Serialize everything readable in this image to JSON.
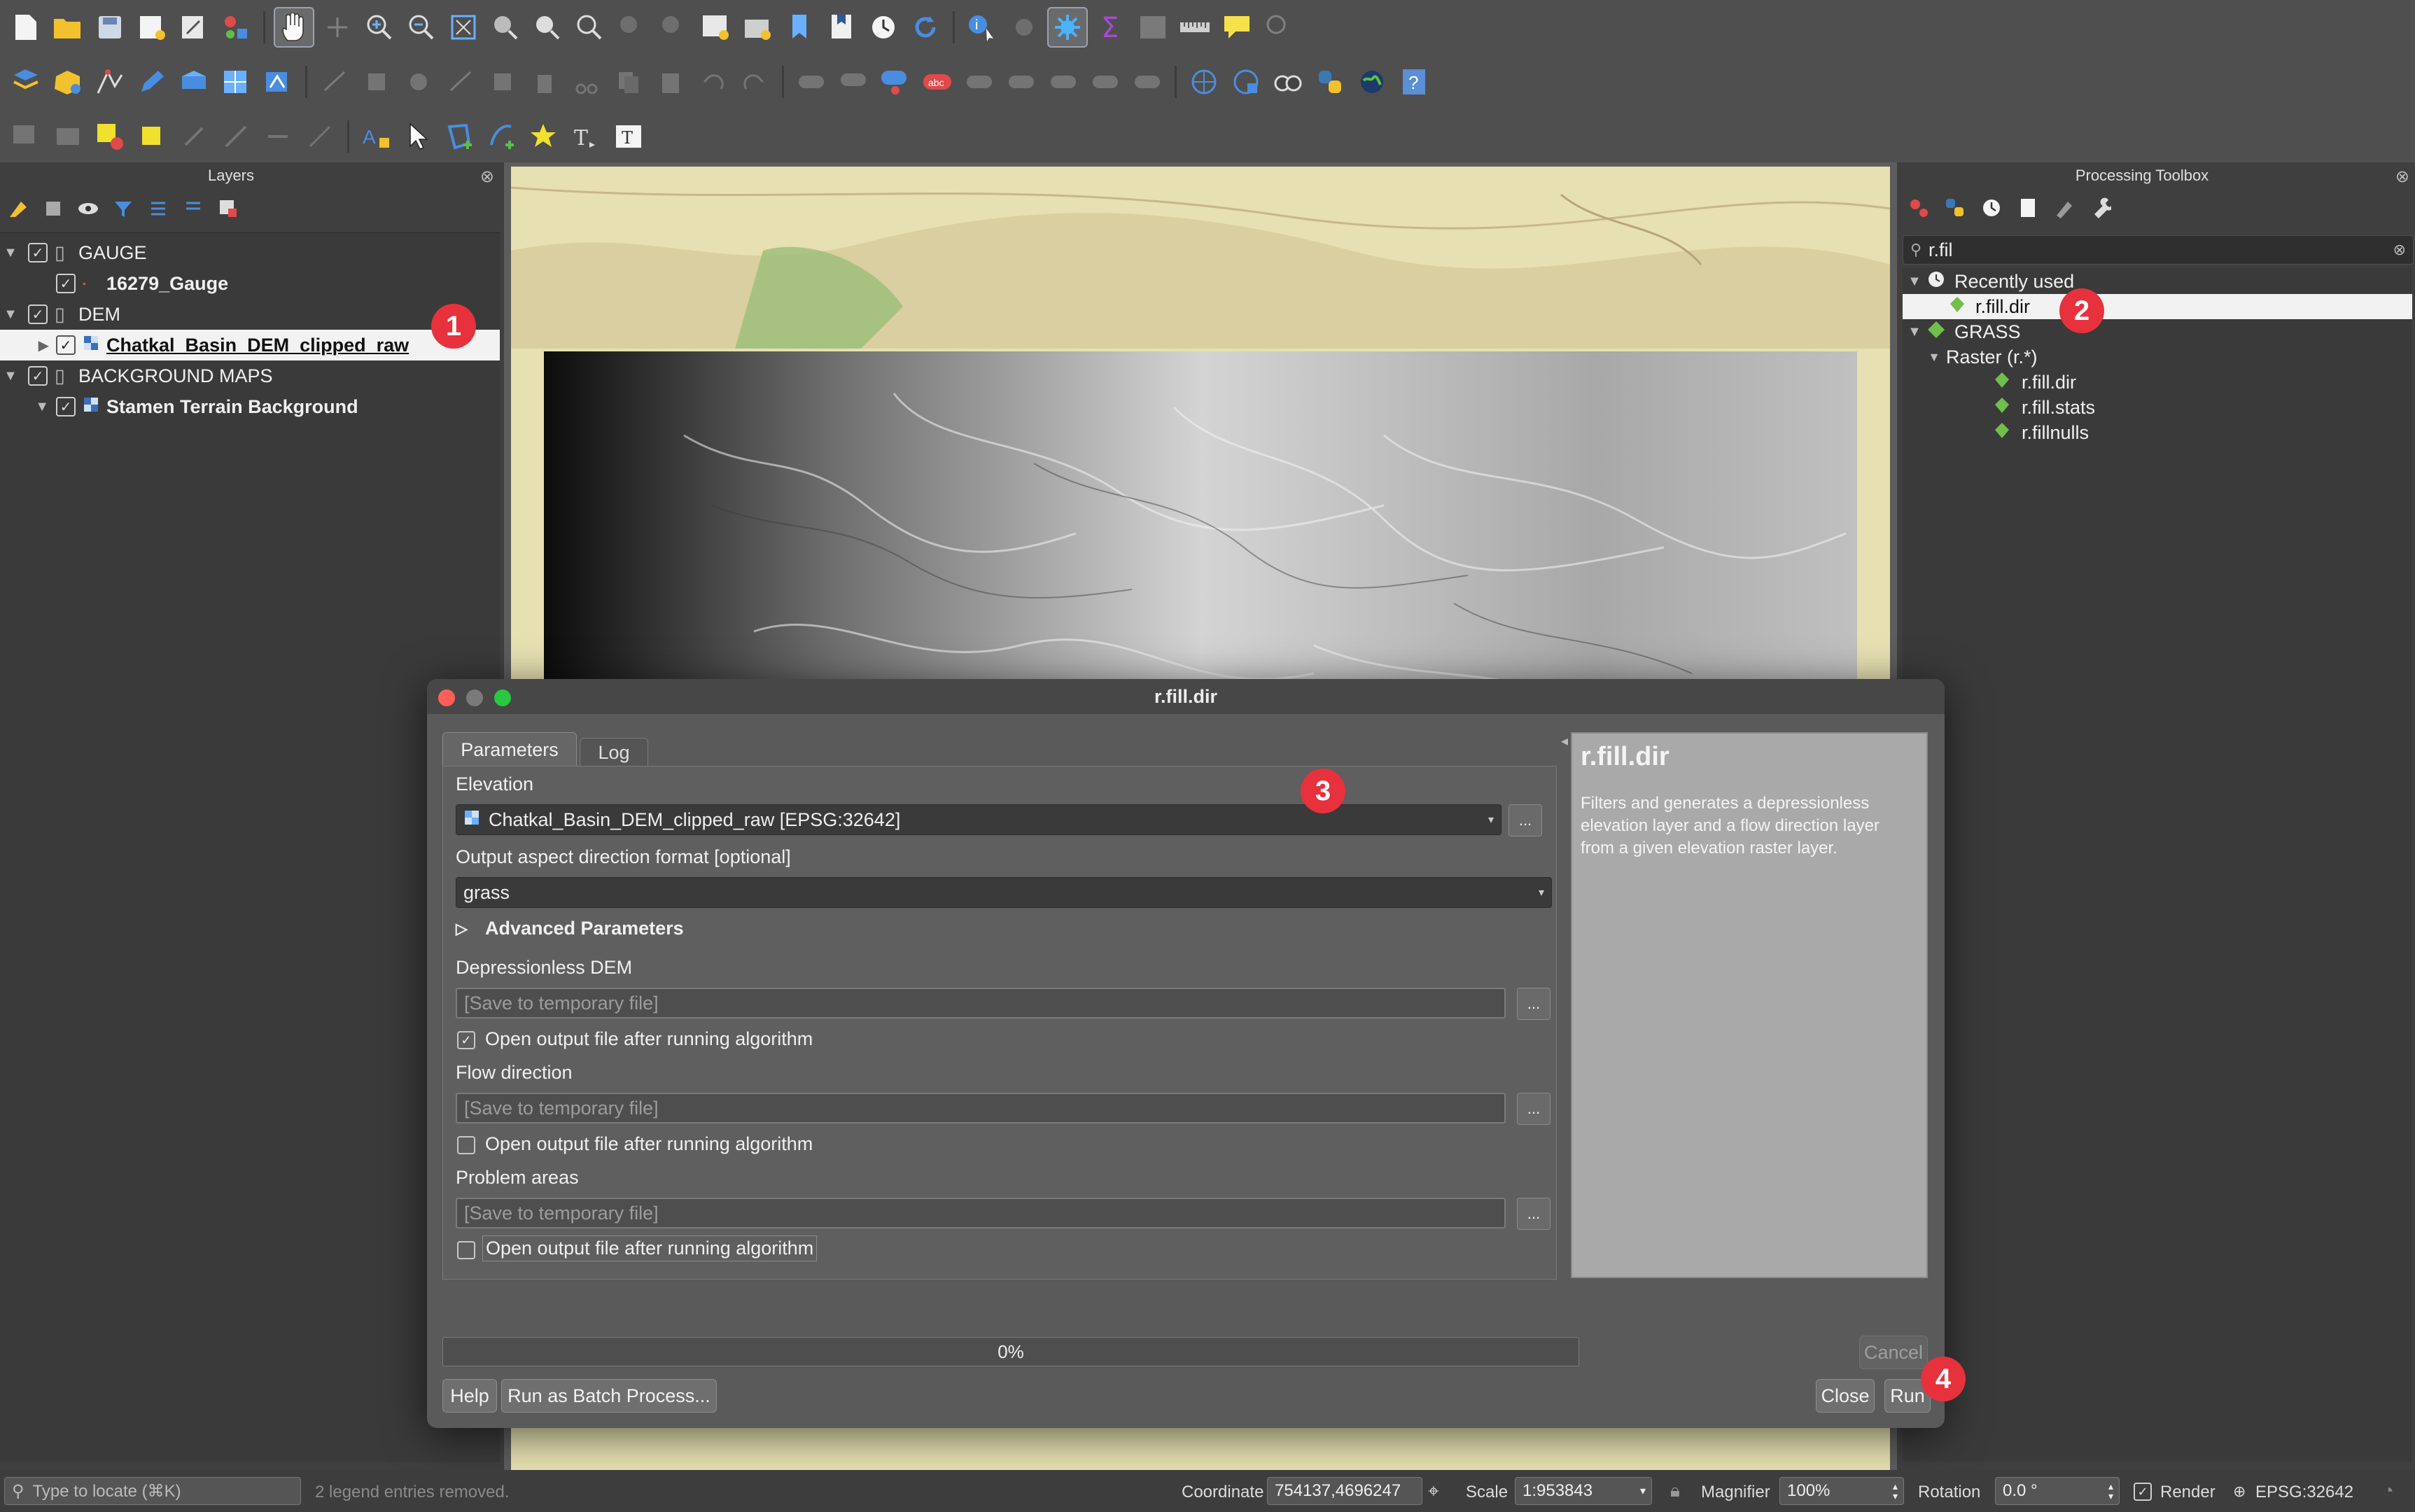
{
  "layers_panel": {
    "title": "Layers",
    "rows": [
      {
        "label": "GAUGE"
      },
      {
        "label": "16279_Gauge"
      },
      {
        "label": "DEM"
      },
      {
        "label": "Chatkal_Basin_DEM_clipped_raw"
      },
      {
        "label": "BACKGROUND MAPS"
      },
      {
        "label": "Stamen Terrain Background"
      }
    ]
  },
  "processing_toolbox": {
    "title": "Processing Toolbox",
    "search_value": "r.fil",
    "tree": [
      {
        "label": "Recently used"
      },
      {
        "label": "r.fill.dir"
      },
      {
        "label": "GRASS"
      },
      {
        "label": "Raster (r.*)"
      },
      {
        "label": "r.fill.dir"
      },
      {
        "label": "r.fill.stats"
      },
      {
        "label": "r.fillnulls"
      }
    ]
  },
  "dialog": {
    "title": "r.fill.dir",
    "tabs": [
      "Parameters",
      "Log"
    ],
    "elevation_label": "Elevation",
    "elevation_value": "Chatkal_Basin_DEM_clipped_raw [EPSG:32642]",
    "aspect_label": "Output aspect direction format [optional]",
    "aspect_value": "grass",
    "advanced_label": "Advanced Parameters",
    "depressionless_label": "Depressionless DEM",
    "flow_label": "Flow direction",
    "problem_label": "Problem areas",
    "temp_placeholder": "[Save to temporary file]",
    "open_output_label": "Open output file after running algorithm",
    "ellipsis": "...",
    "help_title": "r.fill.dir",
    "help_text": "Filters and generates a depressionless elevation layer and a flow direction layer from a given elevation raster layer.",
    "progress_text": "0%",
    "progress_fraction": 0,
    "buttons": {
      "cancel": "Cancel",
      "help": "Help",
      "batch": "Run as Batch Process...",
      "close": "Close",
      "run": "Run"
    }
  },
  "badges": [
    "1",
    "2",
    "3",
    "4"
  ],
  "statusbar": {
    "locate_placeholder": "Type to locate (⌘K)",
    "message": "2 legend entries removed.",
    "coordinate_label": "Coordinate",
    "coordinate_value": "754137,4696247",
    "scale_label": "Scale",
    "scale_value": "1:953843",
    "magnifier_label": "Magnifier",
    "magnifier_value": "100%",
    "rotation_label": "Rotation",
    "rotation_value": "0.0 °",
    "render_label": "Render",
    "crs": "EPSG:32642"
  },
  "colors": {
    "badge": "#e7313d",
    "dialog_bg": "#5a5a5a"
  }
}
